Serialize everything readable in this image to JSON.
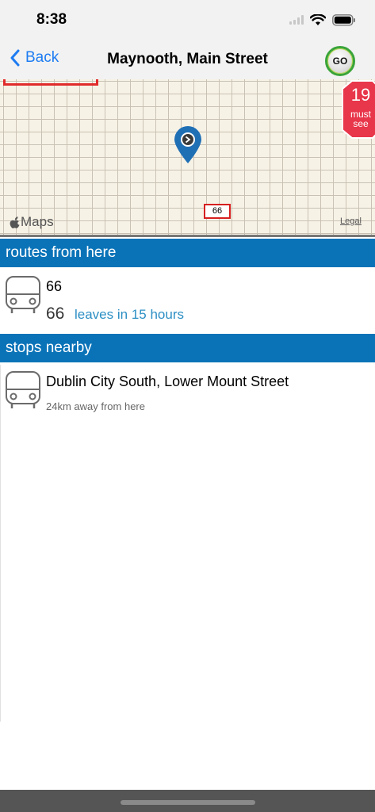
{
  "status": {
    "time": "8:38"
  },
  "nav": {
    "back_label": "Back",
    "title": "Maynooth, Main Street",
    "go_label": "GO"
  },
  "map": {
    "route_label": "66",
    "maps_brand": "Maps",
    "legal_label": "Legal",
    "must_see": {
      "number": "19",
      "line1": "must",
      "line2": "see"
    }
  },
  "routes_section": {
    "header": "routes from here",
    "items": [
      {
        "title": "66",
        "route_number": "66",
        "leaves_text": "leaves in 15 hours"
      }
    ]
  },
  "stops_section": {
    "header": "stops nearby",
    "items": [
      {
        "title": "Dublin City South, Lower Mount Street",
        "distance": "24km away from here"
      }
    ]
  },
  "colors": {
    "accent": "#0a73b8",
    "link": "#1e7cf2",
    "leaves": "#2d8fc4",
    "must_see": "#e8364a"
  }
}
